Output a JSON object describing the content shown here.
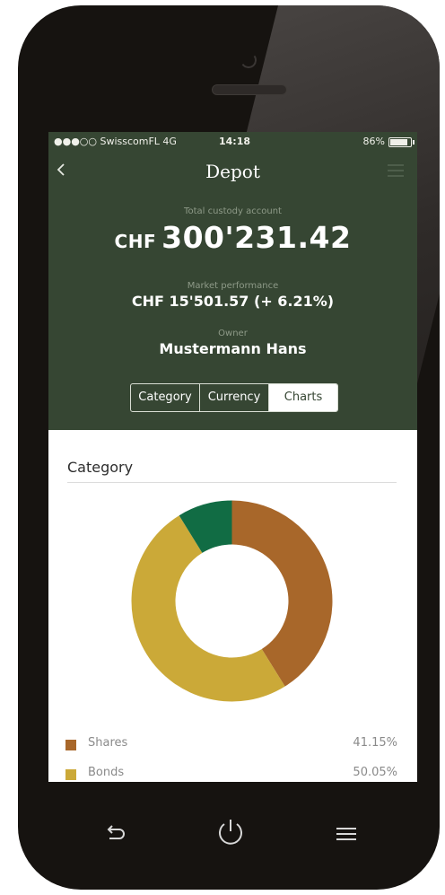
{
  "status_bar": {
    "carrier": "●●●○○ SwisscomFL  4G",
    "time": "14:18",
    "battery": "86%",
    "battery_level": 0.86
  },
  "header": {
    "title": "Depot",
    "total_label": "Total custody account",
    "total_currency": "CHF",
    "total_amount": "300'231.42",
    "performance_label": "Market performance",
    "performance_value": "CHF 15'501.57 (+ 6.21%)",
    "owner_label": "Owner",
    "owner_name": "Mustermann Hans"
  },
  "tabs": [
    {
      "label": "Category",
      "active": false
    },
    {
      "label": "Currency",
      "active": false
    },
    {
      "label": "Charts",
      "active": true
    }
  ],
  "section": {
    "title": "Category"
  },
  "chart_data": {
    "type": "pie",
    "title": "",
    "categories": [
      "Shares",
      "Bonds",
      ""
    ],
    "values": [
      41.15,
      50.05,
      8.8
    ],
    "colors": [
      "#a8672a",
      "#cba938",
      "#116c44"
    ]
  },
  "legend": [
    {
      "name": "Shares",
      "percent": "41.15%",
      "color": "#a8672a"
    },
    {
      "name": "Bonds",
      "percent": "50.05%",
      "color": "#cba938"
    }
  ],
  "colors": {
    "header_bg": "#364633",
    "accent": "#364633"
  }
}
